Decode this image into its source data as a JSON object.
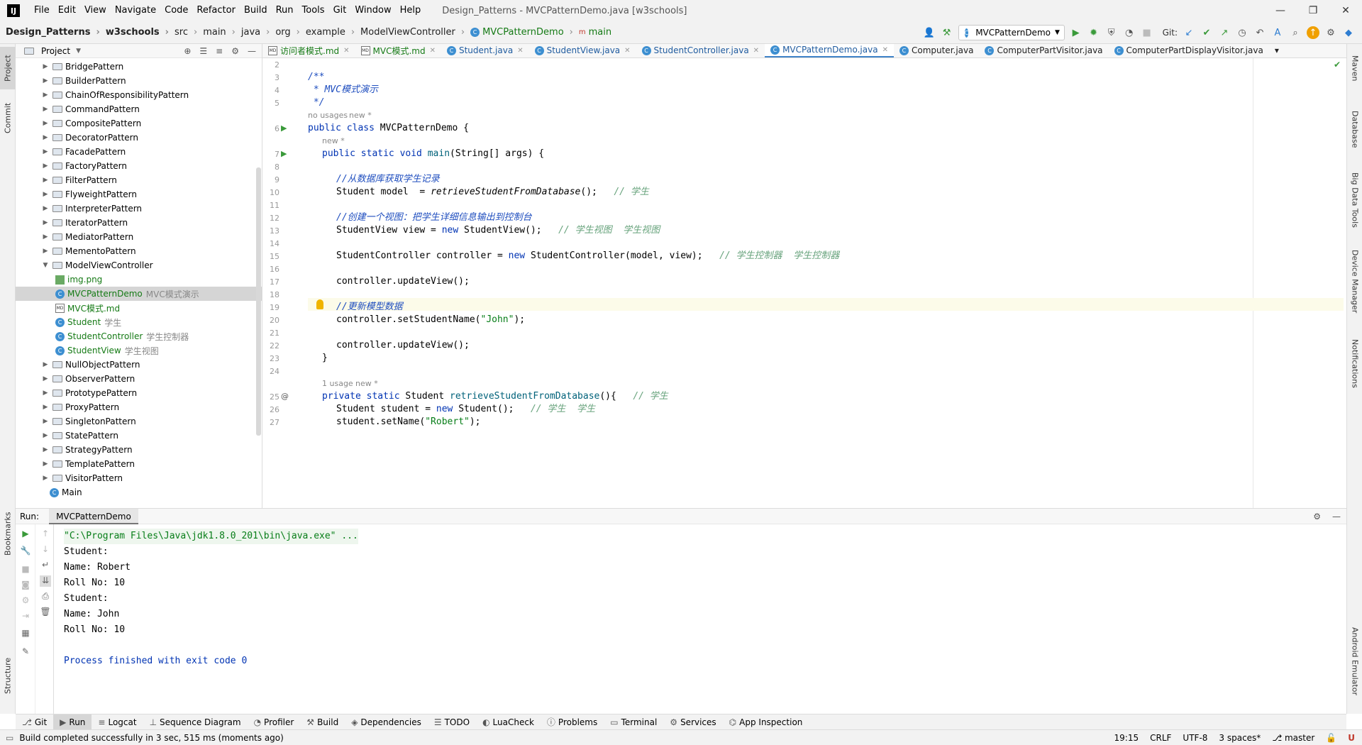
{
  "app": {
    "window_title": "Design_Patterns - MVCPatternDemo.java [w3schools]",
    "logo": "IJ"
  },
  "menu": [
    "File",
    "Edit",
    "View",
    "Navigate",
    "Code",
    "Refactor",
    "Build",
    "Run",
    "Tools",
    "Git",
    "Window",
    "Help"
  ],
  "breadcrumb": [
    "Design_Patterns",
    "w3schools",
    "src",
    "main",
    "java",
    "org",
    "example",
    "ModelViewController",
    "MVCPatternDemo",
    "main"
  ],
  "toolbar": {
    "run_config": "MVCPatternDemo",
    "git_label": "Git:"
  },
  "project_panel": {
    "title": "Project",
    "tree": [
      {
        "name": "BridgePattern",
        "type": "folder"
      },
      {
        "name": "BuilderPattern",
        "type": "folder"
      },
      {
        "name": "ChainOfResponsibilityPattern",
        "type": "folder"
      },
      {
        "name": "CommandPattern",
        "type": "folder"
      },
      {
        "name": "CompositePattern",
        "type": "folder"
      },
      {
        "name": "DecoratorPattern",
        "type": "folder"
      },
      {
        "name": "FacadePattern",
        "type": "folder"
      },
      {
        "name": "FactoryPattern",
        "type": "folder"
      },
      {
        "name": "FilterPattern",
        "type": "folder"
      },
      {
        "name": "FlyweightPattern",
        "type": "folder"
      },
      {
        "name": "InterpreterPattern",
        "type": "folder"
      },
      {
        "name": "IteratorPattern",
        "type": "folder"
      },
      {
        "name": "MediatorPattern",
        "type": "folder"
      },
      {
        "name": "MementoPattern",
        "type": "folder"
      },
      {
        "name": "ModelViewController",
        "type": "folder-open"
      },
      {
        "name": "img.png",
        "type": "image",
        "hint": ""
      },
      {
        "name": "MVCPatternDemo",
        "type": "class",
        "hint": "MVC模式演示",
        "selected": true
      },
      {
        "name": "MVC模式.md",
        "type": "md",
        "hint": ""
      },
      {
        "name": "Student",
        "type": "class",
        "hint": "学生"
      },
      {
        "name": "StudentController",
        "type": "class",
        "hint": "学生控制器"
      },
      {
        "name": "StudentView",
        "type": "class",
        "hint": "学生视图"
      },
      {
        "name": "NullObjectPattern",
        "type": "folder"
      },
      {
        "name": "ObserverPattern",
        "type": "folder"
      },
      {
        "name": "PrototypePattern",
        "type": "folder"
      },
      {
        "name": "ProxyPattern",
        "type": "folder"
      },
      {
        "name": "SingletonPattern",
        "type": "folder"
      },
      {
        "name": "StatePattern",
        "type": "folder"
      },
      {
        "name": "StrategyPattern",
        "type": "folder"
      },
      {
        "name": "TemplatePattern",
        "type": "folder"
      },
      {
        "name": "VisitorPattern",
        "type": "folder"
      },
      {
        "name": "Main",
        "type": "main-class"
      }
    ]
  },
  "editor_tabs": [
    {
      "label": "访问者模式.md",
      "kind": "md"
    },
    {
      "label": "MVC模式.md",
      "kind": "md"
    },
    {
      "label": "Student.java",
      "kind": "java"
    },
    {
      "label": "StudentView.java",
      "kind": "java"
    },
    {
      "label": "StudentController.java",
      "kind": "java"
    },
    {
      "label": "MVCPatternDemo.java",
      "kind": "java",
      "active": true
    },
    {
      "label": "Computer.java",
      "kind": "java2"
    },
    {
      "label": "ComputerPartVisitor.java",
      "kind": "java2"
    },
    {
      "label": "ComputerPartDisplayVisitor.java",
      "kind": "java2"
    }
  ],
  "code": {
    "line_numbers": [
      "2",
      "3",
      "4",
      "5",
      "6",
      "7",
      "8",
      "9",
      "10",
      "11",
      "12",
      "13",
      "14",
      "15",
      "16",
      "17",
      "18",
      "19",
      "20",
      "21",
      "22",
      "23",
      "24",
      "25",
      "26",
      "27"
    ],
    "inlays": {
      "no_usages": "no usages",
      "new_star": "new *",
      "new_star_2": "new *",
      "one_usage": "1 usage",
      "new_star_3": "new *"
    },
    "lines": {
      "l3": "/**",
      "l4": " * MVC模式演示",
      "l5": " */",
      "l6_kw": "public class",
      "l6_rest": " MVCPatternDemo {",
      "l7_kw": "public static void",
      "l7_fn": " main",
      "l7_rest": "(String[] args) {",
      "l9": "//从数据库获取学生记录",
      "l10_a": "Student model  = ",
      "l10_fn": "retrieveStudentFromDatabase",
      "l10_b": "();   ",
      "l10_c": "// 学生",
      "l12": "//创建一个视图：把学生详细信息输出到控制台",
      "l13_a": "StudentView view = ",
      "l13_kw": "new",
      "l13_b": " StudentView();   ",
      "l13_c": "// 学生视图  学生视图",
      "l15_a": "StudentController controller = ",
      "l15_kw": "new",
      "l15_b": " StudentController(model, view);   ",
      "l15_c": "// 学生控制器  学生控制器",
      "l17": "controller.updateView();",
      "l19": "//更新模型数据",
      "l20_a": "controller.setStudentName(",
      "l20_str": "\"John\"",
      "l20_b": ");",
      "l22": "controller.updateView();",
      "l23": "}",
      "l25_kw": "private static",
      "l25_a": " Student ",
      "l25_fn": "retrieveStudentFromDatabase",
      "l25_b": "(){   ",
      "l25_c": "// 学生",
      "l26_a": "Student student = ",
      "l26_kw": "new",
      "l26_b": " Student();   ",
      "l26_c": "// 学生  学生",
      "l27_a": "student.setName(",
      "l27_str": "\"Robert\"",
      "l27_b": ");"
    }
  },
  "run_panel": {
    "label": "Run:",
    "tab": "MVCPatternDemo",
    "console": [
      {
        "text": "\"C:\\Program Files\\Java\\jdk1.8.0_201\\bin\\java.exe\" ...",
        "kind": "cmdline"
      },
      {
        "text": "Student:",
        "kind": "out"
      },
      {
        "text": "Name: Robert",
        "kind": "out"
      },
      {
        "text": "Roll No: 10",
        "kind": "out"
      },
      {
        "text": "Student:",
        "kind": "out"
      },
      {
        "text": "Name: John",
        "kind": "out"
      },
      {
        "text": "Roll No: 10",
        "kind": "out"
      },
      {
        "text": "",
        "kind": "out"
      },
      {
        "text": "Process finished with exit code 0",
        "kind": "exit"
      }
    ]
  },
  "left_stripe": [
    "Project",
    "Commit",
    "Bookmarks",
    "Structure"
  ],
  "right_stripe": [
    "Maven",
    "Database",
    "Big Data Tools",
    "Device Manager",
    "Notifications",
    "Android Emulator"
  ],
  "tool_windows": [
    "Git",
    "Run",
    "Logcat",
    "Sequence Diagram",
    "Profiler",
    "Build",
    "Dependencies",
    "TODO",
    "LuaCheck",
    "Problems",
    "Terminal",
    "Services",
    "App Inspection"
  ],
  "status": {
    "message": "Build completed successfully in 3 sec, 515 ms (moments ago)",
    "position": "19:15",
    "line_sep": "CRLF",
    "encoding": "UTF-8",
    "indent": "3 spaces*",
    "branch": "master"
  },
  "colors": {
    "accent": "#4083c9",
    "keyword": "#0033b3",
    "string": "#067d17",
    "comment_green": "#67a37c"
  }
}
